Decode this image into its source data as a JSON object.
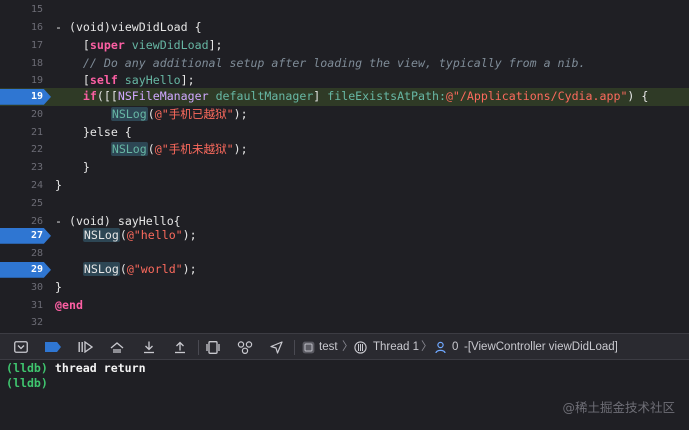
{
  "editor": {
    "lines": [
      {
        "num": "15"
      },
      {
        "num": "16"
      },
      {
        "num": "17"
      },
      {
        "num": "18"
      },
      {
        "num": "19"
      },
      {
        "num": "20"
      },
      {
        "num": "21"
      },
      {
        "num": "22"
      },
      {
        "num": "23"
      },
      {
        "num": "24"
      },
      {
        "num": "25"
      },
      {
        "num": "26"
      },
      {
        "num": "27"
      },
      {
        "num": "28"
      },
      {
        "num": "29"
      },
      {
        "num": "30"
      },
      {
        "num": "31"
      },
      {
        "num": "32"
      }
    ],
    "breakpoint_lines": [
      "19",
      "27",
      "29"
    ],
    "current_line": "19",
    "code": {
      "l16_dash": "- ",
      "l16_void": "(void)",
      "l16_rest": "viewDidLoad {",
      "l17_indent": "    [",
      "l17_super": "super",
      "l17_call": " viewDidLoad",
      "l17_end": "];",
      "l18_comment": "    // Do any additional setup after loading the view, typically from a nib.",
      "l19_indent": "    [",
      "l19_self": "self",
      "l19_call": " sayHello",
      "l19_end": "];",
      "l20_if": "    if",
      "l20_open": "([[",
      "l20_class": "NSFileManager",
      "l20_method": " defaultManager",
      "l20_close": "] ",
      "l20_method2": "fileExistsAtPath:",
      "l20_str": "@\"/Applications/Cydia.app\"",
      "l20_tail": ") {",
      "l21_indent": "        ",
      "l21_fn": "NSLog",
      "l21_open": "(",
      "l21_str": "@\"手机已越狱\"",
      "l21_close": ");",
      "l22_else": "    }else {",
      "l23_indent": "        ",
      "l23_fn": "NSLog",
      "l23_open": "(",
      "l23_str": "@\"手机未越狱\"",
      "l23_close": ");",
      "l24": "    }",
      "l25": "}",
      "l27_dash": "- ",
      "l27_void": "(void)",
      "l27_rest": " sayHello{",
      "l28_indent": "    ",
      "l28_fn": "NSLog",
      "l28_open": "(",
      "l28_str": "@\"hello\"",
      "l28_close": ");",
      "l30_indent": "    ",
      "l30_fn": "NSLog",
      "l30_open": "(",
      "l30_str": "@\"world\"",
      "l30_close": ");",
      "l31": "}",
      "l32": "@end"
    }
  },
  "debug_toolbar": {
    "target": "test",
    "thread": "Thread 1",
    "frame_num": "0",
    "frame": "-[ViewController viewDidLoad]",
    "icons": [
      "hide-debug-area-icon",
      "breakpoints-toggle-icon",
      "continue-icon",
      "step-over-icon",
      "step-into-icon",
      "step-out-icon",
      "debug-view-hierarchy-icon",
      "memory-graph-icon",
      "simulate-location-icon"
    ]
  },
  "console": {
    "lines": [
      {
        "prompt": "(lldb)",
        "command": " thread return"
      },
      {
        "prompt": "(lldb)",
        "command": ""
      }
    ]
  },
  "watermark": "@稀土掘金技术社区",
  "colors": {
    "editor_bg": "#1f1f24",
    "breakpoint": "#2f76d2",
    "current_line_bg": "#2f3a26",
    "keyword": "#fc5fa3",
    "string": "#fc6a5d",
    "comment": "#7f8c98",
    "lldb_prompt": "#3fc46e"
  }
}
